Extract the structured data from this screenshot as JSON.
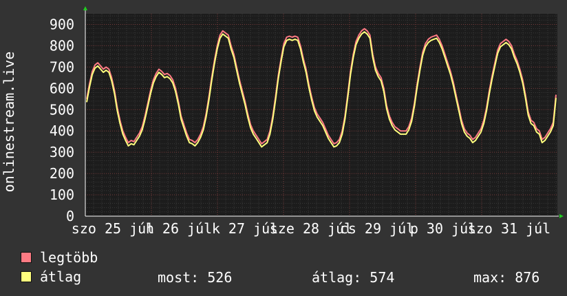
{
  "chart_data": {
    "type": "line",
    "ylabel": "onlinestream.live",
    "ylim": [
      0,
      950
    ],
    "yticks": [
      0,
      100,
      200,
      300,
      400,
      500,
      600,
      700,
      800,
      900
    ],
    "x_tick_labels": [
      "szo 25 júl",
      "h 26 júl",
      "k 27 júl",
      "sze 28 júl",
      "cs 29 júl",
      "p 30 júl",
      "szo 31 júl"
    ],
    "grid": true,
    "series": [
      {
        "name": "legtöbb",
        "color": "#ff7b84",
        "values": [
          550,
          620,
          680,
          710,
          720,
          705,
          690,
          700,
          690,
          650,
          590,
          510,
          450,
          400,
          370,
          345,
          355,
          350,
          370,
          390,
          420,
          470,
          530,
          590,
          640,
          670,
          690,
          680,
          665,
          670,
          660,
          640,
          600,
          540,
          470,
          430,
          390,
          360,
          355,
          345,
          360,
          385,
          420,
          480,
          560,
          650,
          730,
          800,
          850,
          870,
          860,
          850,
          800,
          760,
          700,
          640,
          590,
          540,
          480,
          430,
          400,
          380,
          360,
          340,
          350,
          360,
          400,
          470,
          560,
          660,
          740,
          810,
          840,
          845,
          840,
          845,
          840,
          800,
          740,
          690,
          620,
          560,
          510,
          480,
          460,
          440,
          410,
          380,
          360,
          340,
          345,
          360,
          400,
          470,
          570,
          680,
          760,
          820,
          850,
          870,
          880,
          870,
          850,
          760,
          700,
          670,
          650,
          600,
          520,
          470,
          440,
          420,
          410,
          400,
          400,
          400,
          420,
          460,
          530,
          620,
          700,
          770,
          810,
          830,
          840,
          845,
          850,
          830,
          800,
          760,
          720,
          680,
          630,
          570,
          510,
          450,
          410,
          390,
          380,
          360,
          370,
          390,
          410,
          450,
          510,
          590,
          660,
          720,
          780,
          810,
          820,
          830,
          820,
          800,
          760,
          730,
          690,
          640,
          570,
          490,
          450,
          440,
          410,
          400,
          360,
          370,
          390,
          410,
          440,
          570
        ]
      },
      {
        "name": "átlag",
        "color": "#ffff7e",
        "values": [
          535,
          605,
          665,
          695,
          705,
          690,
          675,
          685,
          675,
          635,
          575,
          495,
          435,
          385,
          355,
          330,
          340,
          335,
          355,
          375,
          405,
          455,
          515,
          575,
          625,
          655,
          675,
          665,
          650,
          655,
          645,
          625,
          585,
          525,
          455,
          415,
          375,
          345,
          340,
          330,
          345,
          370,
          405,
          465,
          545,
          635,
          715,
          785,
          835,
          855,
          845,
          835,
          785,
          745,
          685,
          625,
          575,
          525,
          465,
          415,
          385,
          365,
          345,
          325,
          335,
          345,
          385,
          455,
          545,
          645,
          725,
          795,
          825,
          830,
          825,
          830,
          825,
          785,
          725,
          675,
          605,
          545,
          495,
          465,
          445,
          425,
          395,
          365,
          345,
          325,
          330,
          345,
          385,
          455,
          555,
          665,
          745,
          805,
          835,
          855,
          865,
          855,
          835,
          745,
          685,
          655,
          635,
          585,
          505,
          455,
          425,
          405,
          395,
          385,
          385,
          385,
          405,
          445,
          515,
          605,
          685,
          755,
          795,
          815,
          825,
          830,
          835,
          815,
          785,
          745,
          705,
          665,
          615,
          555,
          495,
          435,
          395,
          375,
          365,
          345,
          355,
          375,
          395,
          435,
          495,
          575,
          645,
          705,
          765,
          795,
          805,
          815,
          805,
          785,
          745,
          715,
          675,
          625,
          555,
          475,
          435,
          425,
          395,
          385,
          345,
          355,
          375,
          395,
          425,
          555
        ]
      }
    ]
  },
  "legend": [
    {
      "label": "legtöbb",
      "color": "#ff7b84"
    },
    {
      "label": "átlag",
      "color": "#ffff7e"
    }
  ],
  "stats": {
    "most": "most: 526",
    "atlag": "átlag: 574",
    "max": "max: 876"
  }
}
